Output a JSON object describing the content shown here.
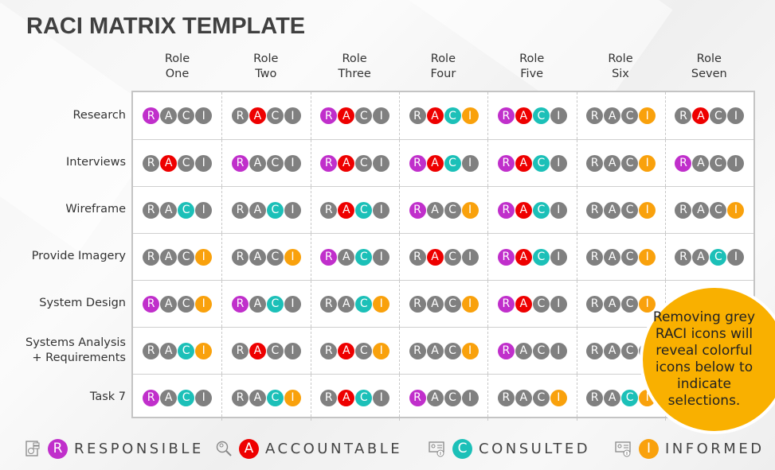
{
  "title": "RACI MATRIX TEMPLATE",
  "roles": [
    {
      "line1": "Role",
      "line2": "One"
    },
    {
      "line1": "Role",
      "line2": "Two"
    },
    {
      "line1": "Role",
      "line2": "Three"
    },
    {
      "line1": "Role",
      "line2": "Four"
    },
    {
      "line1": "Role",
      "line2": "Five"
    },
    {
      "line1": "Role",
      "line2": "Six"
    },
    {
      "line1": "Role",
      "line2": "Seven"
    }
  ],
  "raci_letters": [
    "R",
    "A",
    "C",
    "I"
  ],
  "colors": {
    "R": "#c02fcb",
    "A": "#ee0000",
    "C": "#1cc0b8",
    "I": "#f9a10c",
    "inactive": "#808080",
    "callout": "#f9b000"
  },
  "tasks": [
    {
      "label": "Research",
      "cells": [
        [
          "R"
        ],
        [
          "A"
        ],
        [
          "R",
          "A"
        ],
        [
          "A",
          "C",
          "I"
        ],
        [
          "R",
          "A",
          "C"
        ],
        [
          "I"
        ],
        [
          "A"
        ]
      ]
    },
    {
      "label": "Interviews",
      "cells": [
        [
          "A"
        ],
        [
          "R"
        ],
        [
          "R",
          "A"
        ],
        [
          "R",
          "A",
          "C"
        ],
        [
          "R",
          "A",
          "C"
        ],
        [
          "I"
        ],
        [
          "R"
        ]
      ]
    },
    {
      "label": "Wireframe",
      "cells": [
        [
          "C"
        ],
        [
          "C"
        ],
        [
          "A",
          "C"
        ],
        [
          "R",
          "I"
        ],
        [
          "R",
          "A",
          "C"
        ],
        [
          "I"
        ],
        [
          "I"
        ]
      ]
    },
    {
      "label": "Provide Imagery",
      "cells": [
        [
          "I"
        ],
        [
          "I"
        ],
        [
          "R",
          "C"
        ],
        [
          "A"
        ],
        [
          "R",
          "A",
          "C"
        ],
        [
          "I"
        ],
        [
          "C"
        ]
      ]
    },
    {
      "label": "System Design",
      "cells": [
        [
          "R",
          "I"
        ],
        [
          "R",
          "C"
        ],
        [
          "C",
          "I"
        ],
        [
          "I"
        ],
        [
          "R",
          "A"
        ],
        [
          "I"
        ],
        []
      ]
    },
    {
      "label": "Systems Analysis + Requirements",
      "label_line1": "Systems Analysis",
      "label_line2": "+ Requirements",
      "cells": [
        [
          "C",
          "I"
        ],
        [
          "A"
        ],
        [
          "A",
          "I"
        ],
        [
          "I"
        ],
        [
          "R"
        ],
        [],
        []
      ]
    },
    {
      "label": "Task 7",
      "cells": [
        [
          "R",
          "C"
        ],
        [
          "C",
          "I"
        ],
        [
          "A",
          "C"
        ],
        [
          "R"
        ],
        [
          "I"
        ],
        [
          "C",
          "I"
        ],
        []
      ]
    }
  ],
  "callout": {
    "text": "Removing grey RACI icons will reveal colorful icons below to indicate selections."
  },
  "legend": [
    {
      "letter": "R",
      "label": "RESPONSIBLE",
      "icon": "document-check-icon"
    },
    {
      "letter": "A",
      "label": "ACCOUNTABLE",
      "icon": "magnifier-person-icon"
    },
    {
      "letter": "C",
      "label": "CONSULTED",
      "icon": "contact-card-download-icon"
    },
    {
      "letter": "I",
      "label": "INFORMED",
      "icon": "contact-card-upload-icon"
    }
  ]
}
